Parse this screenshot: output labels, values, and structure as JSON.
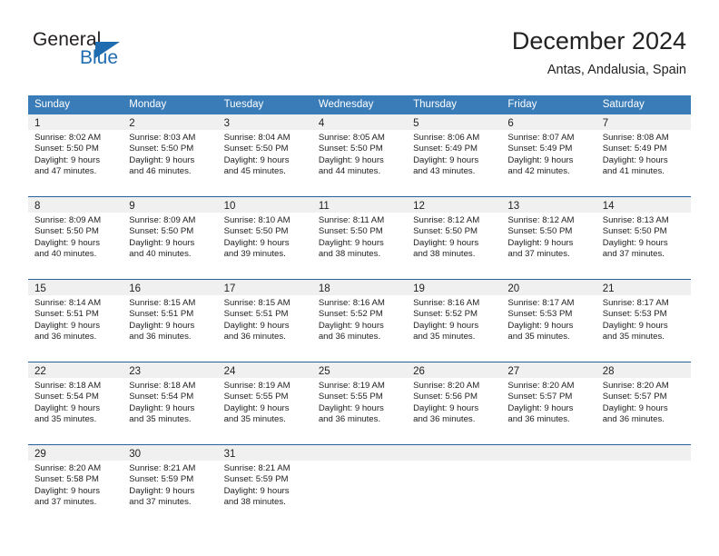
{
  "brand": {
    "name_part1": "General",
    "name_part2": "Blue",
    "flag_icon": "flag-triangle-icon",
    "accent_color": "#1f6cb0"
  },
  "header": {
    "title": "December 2024",
    "subtitle": "Antas, Andalusia, Spain"
  },
  "theme": {
    "header_band": "#3a7cb8",
    "row_separator": "#2a6099",
    "daynum_band": "#f0f0f0",
    "text": "#222222"
  },
  "weekdays": [
    "Sunday",
    "Monday",
    "Tuesday",
    "Wednesday",
    "Thursday",
    "Friday",
    "Saturday"
  ],
  "weeks": [
    [
      {
        "day": "1",
        "sunrise": "Sunrise: 8:02 AM",
        "sunset": "Sunset: 5:50 PM",
        "daylight1": "Daylight: 9 hours",
        "daylight2": "and 47 minutes."
      },
      {
        "day": "2",
        "sunrise": "Sunrise: 8:03 AM",
        "sunset": "Sunset: 5:50 PM",
        "daylight1": "Daylight: 9 hours",
        "daylight2": "and 46 minutes."
      },
      {
        "day": "3",
        "sunrise": "Sunrise: 8:04 AM",
        "sunset": "Sunset: 5:50 PM",
        "daylight1": "Daylight: 9 hours",
        "daylight2": "and 45 minutes."
      },
      {
        "day": "4",
        "sunrise": "Sunrise: 8:05 AM",
        "sunset": "Sunset: 5:50 PM",
        "daylight1": "Daylight: 9 hours",
        "daylight2": "and 44 minutes."
      },
      {
        "day": "5",
        "sunrise": "Sunrise: 8:06 AM",
        "sunset": "Sunset: 5:49 PM",
        "daylight1": "Daylight: 9 hours",
        "daylight2": "and 43 minutes."
      },
      {
        "day": "6",
        "sunrise": "Sunrise: 8:07 AM",
        "sunset": "Sunset: 5:49 PM",
        "daylight1": "Daylight: 9 hours",
        "daylight2": "and 42 minutes."
      },
      {
        "day": "7",
        "sunrise": "Sunrise: 8:08 AM",
        "sunset": "Sunset: 5:49 PM",
        "daylight1": "Daylight: 9 hours",
        "daylight2": "and 41 minutes."
      }
    ],
    [
      {
        "day": "8",
        "sunrise": "Sunrise: 8:09 AM",
        "sunset": "Sunset: 5:50 PM",
        "daylight1": "Daylight: 9 hours",
        "daylight2": "and 40 minutes."
      },
      {
        "day": "9",
        "sunrise": "Sunrise: 8:09 AM",
        "sunset": "Sunset: 5:50 PM",
        "daylight1": "Daylight: 9 hours",
        "daylight2": "and 40 minutes."
      },
      {
        "day": "10",
        "sunrise": "Sunrise: 8:10 AM",
        "sunset": "Sunset: 5:50 PM",
        "daylight1": "Daylight: 9 hours",
        "daylight2": "and 39 minutes."
      },
      {
        "day": "11",
        "sunrise": "Sunrise: 8:11 AM",
        "sunset": "Sunset: 5:50 PM",
        "daylight1": "Daylight: 9 hours",
        "daylight2": "and 38 minutes."
      },
      {
        "day": "12",
        "sunrise": "Sunrise: 8:12 AM",
        "sunset": "Sunset: 5:50 PM",
        "daylight1": "Daylight: 9 hours",
        "daylight2": "and 38 minutes."
      },
      {
        "day": "13",
        "sunrise": "Sunrise: 8:12 AM",
        "sunset": "Sunset: 5:50 PM",
        "daylight1": "Daylight: 9 hours",
        "daylight2": "and 37 minutes."
      },
      {
        "day": "14",
        "sunrise": "Sunrise: 8:13 AM",
        "sunset": "Sunset: 5:50 PM",
        "daylight1": "Daylight: 9 hours",
        "daylight2": "and 37 minutes."
      }
    ],
    [
      {
        "day": "15",
        "sunrise": "Sunrise: 8:14 AM",
        "sunset": "Sunset: 5:51 PM",
        "daylight1": "Daylight: 9 hours",
        "daylight2": "and 36 minutes."
      },
      {
        "day": "16",
        "sunrise": "Sunrise: 8:15 AM",
        "sunset": "Sunset: 5:51 PM",
        "daylight1": "Daylight: 9 hours",
        "daylight2": "and 36 minutes."
      },
      {
        "day": "17",
        "sunrise": "Sunrise: 8:15 AM",
        "sunset": "Sunset: 5:51 PM",
        "daylight1": "Daylight: 9 hours",
        "daylight2": "and 36 minutes."
      },
      {
        "day": "18",
        "sunrise": "Sunrise: 8:16 AM",
        "sunset": "Sunset: 5:52 PM",
        "daylight1": "Daylight: 9 hours",
        "daylight2": "and 36 minutes."
      },
      {
        "day": "19",
        "sunrise": "Sunrise: 8:16 AM",
        "sunset": "Sunset: 5:52 PM",
        "daylight1": "Daylight: 9 hours",
        "daylight2": "and 35 minutes."
      },
      {
        "day": "20",
        "sunrise": "Sunrise: 8:17 AM",
        "sunset": "Sunset: 5:53 PM",
        "daylight1": "Daylight: 9 hours",
        "daylight2": "and 35 minutes."
      },
      {
        "day": "21",
        "sunrise": "Sunrise: 8:17 AM",
        "sunset": "Sunset: 5:53 PM",
        "daylight1": "Daylight: 9 hours",
        "daylight2": "and 35 minutes."
      }
    ],
    [
      {
        "day": "22",
        "sunrise": "Sunrise: 8:18 AM",
        "sunset": "Sunset: 5:54 PM",
        "daylight1": "Daylight: 9 hours",
        "daylight2": "and 35 minutes."
      },
      {
        "day": "23",
        "sunrise": "Sunrise: 8:18 AM",
        "sunset": "Sunset: 5:54 PM",
        "daylight1": "Daylight: 9 hours",
        "daylight2": "and 35 minutes."
      },
      {
        "day": "24",
        "sunrise": "Sunrise: 8:19 AM",
        "sunset": "Sunset: 5:55 PM",
        "daylight1": "Daylight: 9 hours",
        "daylight2": "and 35 minutes."
      },
      {
        "day": "25",
        "sunrise": "Sunrise: 8:19 AM",
        "sunset": "Sunset: 5:55 PM",
        "daylight1": "Daylight: 9 hours",
        "daylight2": "and 36 minutes."
      },
      {
        "day": "26",
        "sunrise": "Sunrise: 8:20 AM",
        "sunset": "Sunset: 5:56 PM",
        "daylight1": "Daylight: 9 hours",
        "daylight2": "and 36 minutes."
      },
      {
        "day": "27",
        "sunrise": "Sunrise: 8:20 AM",
        "sunset": "Sunset: 5:57 PM",
        "daylight1": "Daylight: 9 hours",
        "daylight2": "and 36 minutes."
      },
      {
        "day": "28",
        "sunrise": "Sunrise: 8:20 AM",
        "sunset": "Sunset: 5:57 PM",
        "daylight1": "Daylight: 9 hours",
        "daylight2": "and 36 minutes."
      }
    ],
    [
      {
        "day": "29",
        "sunrise": "Sunrise: 8:20 AM",
        "sunset": "Sunset: 5:58 PM",
        "daylight1": "Daylight: 9 hours",
        "daylight2": "and 37 minutes."
      },
      {
        "day": "30",
        "sunrise": "Sunrise: 8:21 AM",
        "sunset": "Sunset: 5:59 PM",
        "daylight1": "Daylight: 9 hours",
        "daylight2": "and 37 minutes."
      },
      {
        "day": "31",
        "sunrise": "Sunrise: 8:21 AM",
        "sunset": "Sunset: 5:59 PM",
        "daylight1": "Daylight: 9 hours",
        "daylight2": "and 38 minutes."
      },
      {
        "day": "",
        "sunrise": "",
        "sunset": "",
        "daylight1": "",
        "daylight2": ""
      },
      {
        "day": "",
        "sunrise": "",
        "sunset": "",
        "daylight1": "",
        "daylight2": ""
      },
      {
        "day": "",
        "sunrise": "",
        "sunset": "",
        "daylight1": "",
        "daylight2": ""
      },
      {
        "day": "",
        "sunrise": "",
        "sunset": "",
        "daylight1": "",
        "daylight2": ""
      }
    ]
  ]
}
